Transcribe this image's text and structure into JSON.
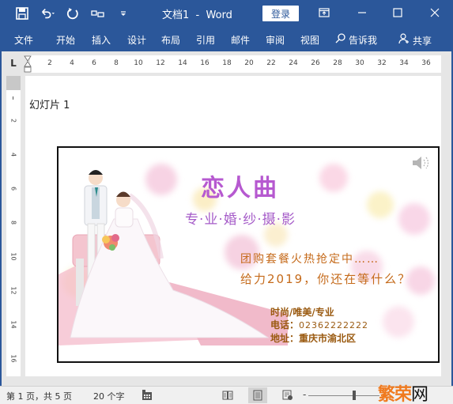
{
  "titlebar": {
    "title": "文档1  -  Word",
    "login_label": "登录",
    "qat_icons": [
      "save-icon",
      "undo-icon",
      "redo-icon",
      "touch-mode-icon",
      "customize-qat-icon"
    ],
    "window_controls": [
      "ribbon-display-options-icon",
      "minimize-icon",
      "maximize-icon",
      "close-icon"
    ]
  },
  "ribbon": {
    "tabs": [
      {
        "label": "文件"
      },
      {
        "label": "开始"
      },
      {
        "label": "插入"
      },
      {
        "label": "设计"
      },
      {
        "label": "布局"
      },
      {
        "label": "引用"
      },
      {
        "label": "邮件"
      },
      {
        "label": "审阅"
      },
      {
        "label": "视图"
      }
    ],
    "tell_me": "告诉我",
    "share": "共享"
  },
  "ruler": {
    "corner": "L",
    "horizontal_numbers": [
      "2",
      "4",
      "6",
      "8",
      "10",
      "12",
      "14",
      "16",
      "18",
      "20",
      "22",
      "24",
      "26",
      "28",
      "30",
      "32",
      "34",
      "36"
    ],
    "vertical_numbers": [
      "2",
      "4",
      "6",
      "8",
      "10",
      "12",
      "14",
      "16"
    ]
  },
  "document": {
    "slide_label": "幻灯片 1",
    "slide": {
      "title": "恋人曲",
      "subtitle": "专·业·婚·纱·摄·影",
      "promo_line1": "团购套餐火热抢定中……",
      "promo_line2": "给力2019，你还在等什么？",
      "tagline": "时尚/唯美/专业",
      "phone_label": "电话：",
      "phone_value": "02362222222",
      "address_label": "地址：",
      "address_value": "重庆市渝北区",
      "audio_icon": "speaker-icon"
    }
  },
  "statusbar": {
    "page_info": "第 1 页，共 5 页",
    "word_count": "20 个字",
    "zoom_level_fraction": 0.62,
    "watermark_part1": "繁荣",
    "watermark_part2": "网"
  },
  "colors": {
    "brand": "#2b579a",
    "slide_title": "#b659d0",
    "promo_text": "#c56a1a",
    "watermark": "#f07a1e"
  }
}
